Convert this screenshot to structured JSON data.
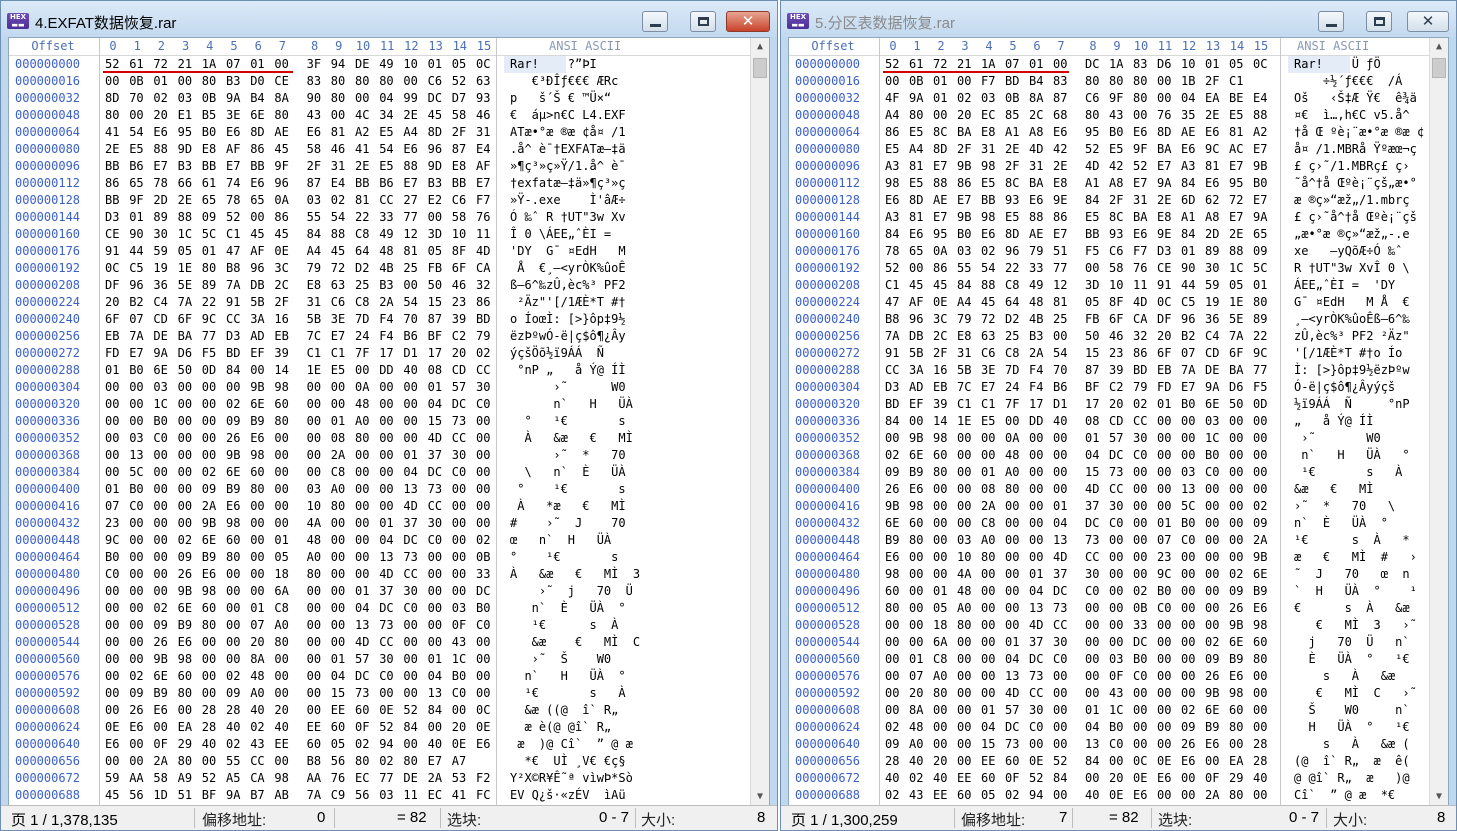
{
  "header": {
    "offset_label": "Offset",
    "columns": [
      "0",
      "1",
      "2",
      "3",
      "4",
      "5",
      "6",
      "7",
      "8",
      "9",
      "10",
      "11",
      "12",
      "13",
      "14",
      "15"
    ],
    "ansi_label": "ANSI ASCII"
  },
  "windows": [
    {
      "title": "4.EXFAT数据恢复.rar",
      "offsets": [
        "000000000",
        "000000016",
        "000000032",
        "000000048",
        "000000064",
        "000000080",
        "000000096",
        "000000112",
        "000000128",
        "000000144",
        "000000160",
        "000000176",
        "000000192",
        "000000208",
        "000000224",
        "000000240",
        "000000256",
        "000000272",
        "000000288",
        "000000304",
        "000000320",
        "000000336",
        "000000352",
        "000000368",
        "000000384",
        "000000400",
        "000000416",
        "000000432",
        "000000448",
        "000000464",
        "000000480",
        "000000496",
        "000000512",
        "000000528",
        "000000544",
        "000000560",
        "000000576",
        "000000592",
        "000000608",
        "000000624",
        "000000640",
        "000000656",
        "000000672",
        "000000688"
      ],
      "hex": [
        "52 61 72 21 1A 07 01 00 3F 94 DE 49 10 01 05 0C",
        "00 0B 01 00 80 B3 D0 CE 83 80 80 80 00 C6 52 63",
        "8D 70 02 03 0B 9A B4 8A 90 80 00 04 99 DC D7 93",
        "80 00 20 E1 B5 3E 6E 80 43 00 4C 34 2E 45 58 46",
        "41 54 E6 95 B0 E6 8D AE E6 81 A2 E5 A4 8D 2F 31",
        "2E E5 88 9D E8 AF 86 45 58 46 41 54 E6 96 87 E4",
        "BB B6 E7 B3 BB E7 BB 9F 2F 31 2E E5 88 9D E8 AF",
        "86 65 78 66 61 74 E6 96 87 E4 BB B6 E7 B3 BB E7",
        "BB 9F 2D 2E 65 78 65 0A 03 02 81 CC 27 E2 C6 F7",
        "D3 01 89 88 09 52 00 86 55 54 22 33 77 00 58 76",
        "CE 90 30 1C 5C C1 45 45 84 88 C8 49 12 3D 10 11",
        "91 44 59 05 01 47 AF 0E A4 45 64 48 81 05 8F 4D",
        "0C C5 19 1E 80 B8 96 3C 79 72 D2 4B 25 FB 6F CA",
        "DF 96 36 5E 89 7A DB 2C E8 63 25 B3 00 50 46 32",
        "20 B2 C4 7A 22 91 5B 2F 31 C6 C8 2A 54 15 23 86",
        "6F 07 CD 6F 9C CC 3A 16 5B 3E 7D F4 70 87 39 BD",
        "EB 7A DE BA 77 D3 AD EB 7C E7 24 F4 B6 BF C2 79",
        "FD E7 9A D6 F5 BD EF 39 C1 C1 7F 17 D1 17 20 02",
        "01 B0 6E 50 0D 84 00 14 1E E5 00 DD 40 08 CD CC",
        "00 00 03 00 00 00 9B 98 00 00 0A 00 00 01 57 30",
        "00 00 1C 00 00 02 6E 60 00 00 48 00 00 04 DC C0",
        "00 00 B0 00 00 09 B9 80 00 01 A0 00 00 15 73 00",
        "00 03 C0 00 00 26 E6 00 00 08 80 00 00 4D CC 00",
        "00 13 00 00 00 9B 98 00 00 2A 00 00 01 37 30 00",
        "00 5C 00 00 02 6E 60 00 00 C8 00 00 04 DC C0 00",
        "01 B0 00 00 09 B9 80 00 03 A0 00 00 13 73 00 00",
        "07 C0 00 00 2A E6 00 00 10 80 00 00 4D CC 00 00",
        "23 00 00 00 9B 98 00 00 4A 00 00 01 37 30 00 00",
        "9C 00 00 02 6E 60 00 01 48 00 00 04 DC C0 00 02",
        "B0 00 00 09 B9 80 00 05 A0 00 00 13 73 00 00 0B",
        "C0 00 00 26 E6 00 00 18 80 00 00 4D CC 00 00 33",
        "00 00 00 9B 98 00 00 6A 00 00 01 37 30 00 00 DC",
        "00 00 02 6E 60 00 01 C8 00 00 04 DC C0 00 03 B0",
        "00 00 09 B9 80 00 07 A0 00 00 13 73 00 00 0F C0",
        "00 00 26 E6 00 00 20 80 00 00 4D CC 00 00 43 00",
        "00 00 9B 98 00 00 8A 00 00 01 57 30 00 01 1C 00",
        "00 02 6E 60 00 02 48 00 00 04 DC C0 00 04 B0 00",
        "00 09 B9 80 00 09 A0 00 00 15 73 00 00 13 C0 00",
        "00 26 E6 00 28 28 40 20 00 EE 60 0E 52 84 00 0C",
        "0E E6 00 EA 28 40 02 40 EE 60 0F 52 84 00 20 0E",
        "E6 00 0F 29 40 02 43 EE 60 05 02 94 00 40 0E E6",
        "00 00 2A 80 00 55 CC 00 B8 56 80 02 80 E7 A7",
        "59 AA 58 A9 52 A5 CA 98 AA 76 EC 77 DE 2A 53 F2",
        "45 56 1D 51 BF 9A B7 AB 7A C9 56 03 11 EC 41 FC"
      ],
      "ascii": [
        "Rar!    ?”ÞI",
        "   €³ÐÎƒ€€€ ÆRc",
        "p   š´Š € ™Ü×“",
        "€  áµ>n€C L4.EXF",
        "ATæ•°æ ®æ ¢å¤ /1",
        ".å^ è¯†EXFATæ–‡ä",
        "»¶ç³»ç»Ÿ/1.å^ è¯",
        "†exfatæ–‡ä»¶ç³»ç",
        "»Ÿ-.exe    Ì'âÆ÷",
        "Ó ‰ˆ R †UT\"3w Xv",
        "Î 0 \\ÁEE„ˆÈI =",
        "'DY  G¯ ¤EdH   M",
        " Å  €¸–<yrÒK%ûoÊ",
        "ß–6^‰zÛ,èc%³ PF2",
        " ²Äz\"'[/1ÆÈ*T #†",
        "o ÍoœÌ: [>}ôp‡9½",
        "ëzÞºwÓ-ë|ç$ô¶¿Ây",
        "ýçšÖõ½ï9ÁÁ  Ñ",
        " °nP „   å Ý@ ÍÌ",
        "      ›˜      W0",
        "      n`   H   ÜÀ",
        "  °   ¹€       s",
        "  À   &æ   €   MÌ",
        "      ›˜  *   70",
        "  \\   n`  È   ÜÀ",
        " °    ¹€       s",
        " À   *æ   €   MÌ",
        "#    ›˜  J    70",
        "œ   n`  H   ÜÀ",
        "°    ¹€       s",
        "À   &æ   €   MÌ  3",
        "    ›˜  j   70  Ü",
        "   n`  È   ÜÀ  °",
        "   ¹€      s  À",
        "   &æ    €   MÌ  C",
        "   ›˜  Š    W0",
        "  n`   H   ÜÀ  °",
        "  ¹€       s   À",
        "  &æ ((@  î` R„",
        "  æ è(@ @î` R„",
        " æ  )@ Cî`  ” @ æ",
        "  *€  UÌ ¸V€ €ç§",
        "Y²X©R¥Ê˜ª vìwÞ*Sò",
        "EV Q¿š·«zÉV  ìAü"
      ],
      "status": {
        "page_label": "页 1 / 1,378,135",
        "offset_label": "偏移地址:",
        "offset_value": "0",
        "value_label": "= 82",
        "block_label": "选块:",
        "block_value": "0 - 7",
        "size_label": "大小:",
        "size_value": "8"
      }
    },
    {
      "title": "5.分区表数据恢复.rar",
      "offsets": [
        "000000000",
        "000000016",
        "000000032",
        "000000048",
        "000000064",
        "000000080",
        "000000096",
        "000000112",
        "000000128",
        "000000144",
        "000000160",
        "000000176",
        "000000192",
        "000000208",
        "000000224",
        "000000240",
        "000000256",
        "000000272",
        "000000288",
        "000000304",
        "000000320",
        "000000336",
        "000000352",
        "000000368",
        "000000384",
        "000000400",
        "000000416",
        "000000432",
        "000000448",
        "000000464",
        "000000480",
        "000000496",
        "000000512",
        "000000528",
        "000000544",
        "000000560",
        "000000576",
        "000000592",
        "000000608",
        "000000624",
        "000000640",
        "000000656",
        "000000672",
        "000000688"
      ],
      "hex": [
        "52 61 72 21 1A 07 01 00 DC 1A 83 D6 10 01 05 0C",
        "00 0B 01 00 F7 BD B4 83 80 80 80 00 1B 2F C1",
        "4F 9A 01 02 03 0B 8A 87 C6 9F 80 00 04 EA BE E4",
        "A4 80 00 20 EC 85 2C 68 80 43 00 76 35 2E E5 88",
        "86 E5 8C BA E8 A1 A8 E6 95 B0 E6 8D AE E6 81 A2",
        "E5 A4 8D 2F 31 2E 4D 42 52 E5 9F BA E6 9C AC E7",
        "A3 81 E7 9B 98 2F 31 2E 4D 42 52 E7 A3 81 E7 9B",
        "98 E5 88 86 E5 8C BA E8 A1 A8 E7 9A 84 E6 95 B0",
        "E6 8D AE E7 BB 93 E6 9E 84 2F 31 2E 6D 62 72 E7",
        "A3 81 E7 9B 98 E5 88 86 E5 8C BA E8 A1 A8 E7 9A",
        "84 E6 95 B0 E6 8D AE E7 BB 93 E6 9E 84 2D 2E 65",
        "78 65 0A 03 02 96 79 51 F5 C6 F7 D3 01 89 88 09",
        "52 00 86 55 54 22 33 77 00 58 76 CE 90 30 1C 5C",
        "C1 45 45 84 88 C8 49 12 3D 10 11 91 44 59 05 01",
        "47 AF 0E A4 45 64 48 81 05 8F 4D 0C C5 19 1E 80",
        "B8 96 3C 79 72 D2 4B 25 FB 6F CA DF 96 36 5E 89",
        "7A DB 2C E8 63 25 B3 00 50 46 32 20 B2 C4 7A 22",
        "91 5B 2F 31 C6 C8 2A 54 15 23 86 6F 07 CD 6F 9C",
        "CC 3A 16 5B 3E 7D F4 70 87 39 BD EB 7A DE BA 77",
        "D3 AD EB 7C E7 24 F4 B6 BF C2 79 FD E7 9A D6 F5",
        "BD EF 39 C1 C1 7F 17 D1 17 20 02 01 B0 6E 50 0D",
        "84 00 14 1E E5 00 DD 40 08 CD CC 00 00 03 00 00",
        "00 9B 98 00 00 0A 00 00 01 57 30 00 00 1C 00 00",
        "02 6E 60 00 00 48 00 00 04 DC C0 00 00 B0 00 00",
        "09 B9 80 00 01 A0 00 00 15 73 00 00 03 C0 00 00",
        "26 E6 00 00 08 80 00 00 4D CC 00 00 13 00 00 00",
        "9B 98 00 00 2A 00 00 01 37 30 00 00 5C 00 00 02",
        "6E 60 00 00 C8 00 00 04 DC C0 00 01 B0 00 00 09",
        "B9 80 00 03 A0 00 00 13 73 00 00 07 C0 00 00 2A",
        "E6 00 00 10 80 00 00 4D CC 00 00 23 00 00 00 9B",
        "98 00 00 4A 00 00 01 37 30 00 00 9C 00 00 02 6E",
        "60 00 01 48 00 00 04 DC C0 00 02 B0 00 00 09 B9",
        "80 00 05 A0 00 00 13 73 00 00 0B C0 00 00 26 E6",
        "00 00 18 80 00 00 4D CC 00 00 33 00 00 00 9B 98",
        "00 00 6A 00 00 01 37 30 00 00 DC 00 00 02 6E 60",
        "00 01 C8 00 00 04 DC C0 00 03 B0 00 00 09 B9 80",
        "00 07 A0 00 00 13 73 00 00 0F C0 00 00 26 E6 00",
        "00 20 80 00 00 4D CC 00 00 43 00 00 00 9B 98 00",
        "00 8A 00 00 01 57 30 00 01 1C 00 00 02 6E 60 00",
        "02 48 00 00 04 DC C0 00 04 B0 00 00 09 B9 80 00",
        "09 A0 00 00 15 73 00 00 13 C0 00 00 26 E6 00 28",
        "28 40 20 00 EE 60 0E 52 84 00 0C 0E E6 00 EA 28",
        "40 02 40 EE 60 0F 52 84 00 20 0E E6 00 0F 29 40",
        "02 43 EE 60 05 02 94 00 40 0E E6 00 00 2A 80 00"
      ],
      "ascii": [
        "Rar!    Ü ƒÖ",
        "    ÷½´ƒ€€€  /Á",
        "Oš   ‹Š‡Æ Ÿ€  ê¾ä",
        "¤€  ì…,h€C v5.å^",
        "†å Œ ºè¡¨æ•°æ ®æ ¢",
        "å¤ /1.MBRå Ÿºæœ¬ç",
        "£ ç›˜/1.MBRç£ ç›",
        "˜å^†å Œºè¡¨çš„æ•°",
        "æ ®ç»“æž„/1.mbrç",
        "£ ç›˜å^†å Œºè¡¨çš",
        "„æ•°æ ®ç»“æž„-.e",
        "xe   –yQõÆ÷Ó ‰ˆ",
        "R †UT\"3w XvÎ 0 \\",
        "ÁEE„ˆÈI =  'DY",
        "G¯ ¤EdH   M Å  €",
        "¸–<yrÒK%ûoÊß–6^‰",
        "zÛ,èc%³ PF2 ²Äz\"",
        "'[/1ÆÈ*T #†o Ío",
        "Ì: [>}ôp‡9½ëzÞºw",
        "Ó-ë|ç$ô¶¿Âyýçš",
        "½ï9ÁÁ  Ñ     °nP",
        "„   å Ý@ ÍÌ",
        " ›˜       W0",
        " n`   H   ÜÀ   °",
        " ¹€       s   À",
        "&æ   €   MÌ",
        "›˜  *   70   \\",
        "n`  È   ÜÀ  °",
        "¹€      s  À   *",
        "æ   €   MÌ  #   ›",
        "˜  J   70   œ  n",
        "`  H   ÜÀ  °    ¹",
        "€      s  À   &æ",
        "   €   MÌ  3   ›˜",
        "  j   70  Ü   n`",
        "  È   ÜÀ  °   ¹€",
        "    s   À   &æ",
        "   €   MÌ  C   ›˜",
        "  Š    W0     n`",
        "  H   ÜÀ  °   ¹€",
        "    s   À   &æ (",
        "(@  î` R„  æ  ê(",
        "@ @î` R„  æ   )@",
        "Cî`  ” @ æ  *€"
      ],
      "status": {
        "page_label": "页 1 / 1,300,259",
        "offset_label": "偏移地址:",
        "offset_value": "7",
        "value_label": "= 82",
        "block_label": "选块:",
        "block_value": "0 - 7",
        "size_label": "大小:",
        "size_value": "8"
      }
    }
  ]
}
